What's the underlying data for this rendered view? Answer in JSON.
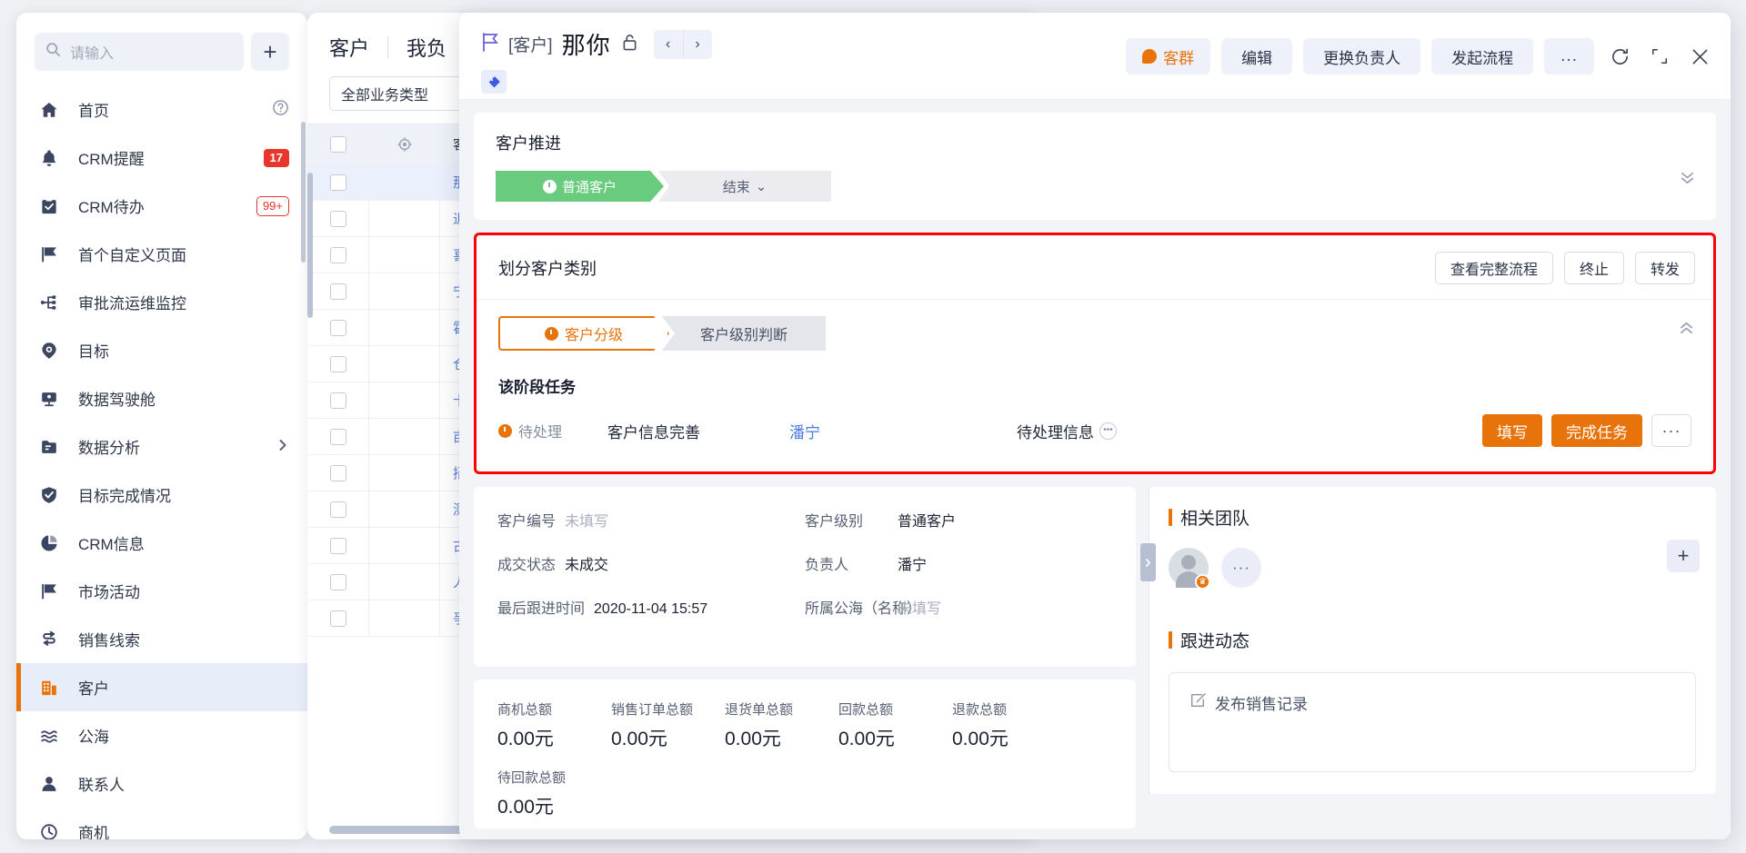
{
  "sidebar": {
    "search": {
      "placeholder": "请输入"
    },
    "add_label": "+",
    "items": [
      {
        "label": "首页",
        "icon": "home-icon",
        "right": "?",
        "right_type": "help"
      },
      {
        "label": "CRM提醒",
        "icon": "bell-icon",
        "right": "17",
        "right_type": "badge"
      },
      {
        "label": "CRM待办",
        "icon": "task-icon",
        "right": "99+",
        "right_type": "badge-outline"
      },
      {
        "label": "首个自定义页面",
        "icon": "flag-icon",
        "right": "",
        "right_type": "none"
      },
      {
        "label": "审批流运维监控",
        "icon": "workflow-icon",
        "right": "",
        "right_type": "none"
      },
      {
        "label": "目标",
        "icon": "target-icon",
        "right": "",
        "right_type": "none"
      },
      {
        "label": "数据驾驶舱",
        "icon": "dashboard-icon",
        "right": "",
        "right_type": "none"
      },
      {
        "label": "数据分析",
        "icon": "analysis-icon",
        "right": "›",
        "right_type": "chevron"
      },
      {
        "label": "目标完成情况",
        "icon": "check-icon",
        "right": "",
        "right_type": "none"
      },
      {
        "label": "CRM信息",
        "icon": "pie-icon",
        "right": "",
        "right_type": "none"
      },
      {
        "label": "市场活动",
        "icon": "flag-icon",
        "right": "",
        "right_type": "none"
      },
      {
        "label": "销售线索",
        "icon": "leads-icon",
        "right": "",
        "right_type": "none"
      },
      {
        "label": "客户",
        "icon": "building-icon",
        "right": "",
        "right_type": "none",
        "active": true
      },
      {
        "label": "公海",
        "icon": "waves-icon",
        "right": "",
        "right_type": "none"
      },
      {
        "label": "联系人",
        "icon": "person-icon",
        "right": "",
        "right_type": "none"
      },
      {
        "label": "商机",
        "icon": "opportunity-icon",
        "right": "",
        "right_type": "none"
      }
    ]
  },
  "list_panel": {
    "tabs": [
      "客户",
      "我负"
    ],
    "filter_label": "全部业务类型",
    "header_name": "客",
    "rows": [
      "那",
      "退",
      "喜",
      "宁",
      "霍",
      "仓",
      "卡",
      "亩",
      "招",
      "测",
      "古",
      "人",
      "爭"
    ]
  },
  "detail": {
    "tag": "[客户]",
    "name": "那你",
    "lock_icon": "unlock-icon",
    "nav_prev": "‹",
    "nav_next": "›",
    "actions": {
      "chat": "客群",
      "edit": "编辑",
      "change_owner": "更换负责人",
      "start_flow": "发起流程",
      "more": "...",
      "refresh_icon": "refresh-icon",
      "expand_icon": "expand-icon",
      "close_icon": "close-icon"
    },
    "progress": {
      "title": "客户推进",
      "stages": [
        {
          "label": "普通客户",
          "state": "active"
        },
        {
          "label": "结束",
          "state": "pending",
          "caret": "⌄"
        }
      ],
      "collapse_icon": "chevron-double-down-icon"
    },
    "flagged": {
      "title": "划分客户类别",
      "buttons": [
        "查看完整流程",
        "终止",
        "转发"
      ],
      "substages": [
        {
          "label": "客户分级",
          "state": "active"
        },
        {
          "label": "客户级别判断",
          "state": "pending"
        }
      ],
      "collapse_icon": "chevron-double-up-icon",
      "task_section_title": "该阶段任务",
      "task": {
        "status": "待处理",
        "name": "客户信息完善",
        "owner": "潘宁",
        "info": "待处理信息",
        "info_icon": "ellipsis-circle-icon",
        "btn_fill": "填写",
        "btn_complete": "完成任务",
        "btn_more": "···"
      },
      "border_color": "#ff0000"
    },
    "fields": {
      "left": [
        {
          "label": "客户编号",
          "value": "未填写",
          "empty": true
        },
        {
          "label": "成交状态",
          "value": "未成交",
          "empty": false
        },
        {
          "label": "最后跟进时间",
          "value": "2020-11-04 15:57",
          "empty": false
        }
      ],
      "right": [
        {
          "label": "客户级别",
          "value": "普通客户",
          "empty": false
        },
        {
          "label": "负责人",
          "value": "潘宁",
          "empty": false
        },
        {
          "label": "所属公海（名称）",
          "value": "未填写",
          "empty": true
        }
      ]
    },
    "stats": [
      {
        "label": "商机总额",
        "value": "0.00元"
      },
      {
        "label": "销售订单总额",
        "value": "0.00元"
      },
      {
        "label": "退货单总额",
        "value": "0.00元"
      },
      {
        "label": "回款总额",
        "value": "0.00元"
      },
      {
        "label": "退款总额",
        "value": "0.00元"
      }
    ],
    "stats_row2": [
      {
        "label": "待回款总额",
        "value": "0.00元"
      }
    ],
    "right_panel": {
      "team_title": "相关团队",
      "team_more": "···",
      "add_label": "+",
      "dynamics_title": "跟进动态",
      "post_label": "发布销售记录",
      "post_icon": "edit-square-icon",
      "splitter_icon": "chevron-right-icon"
    }
  },
  "colors": {
    "accent_orange": "#e8730b",
    "green": "#69cb7d",
    "red_border": "#ff0000",
    "link_blue": "#4a7be0",
    "badge_red": "#e8362c"
  }
}
